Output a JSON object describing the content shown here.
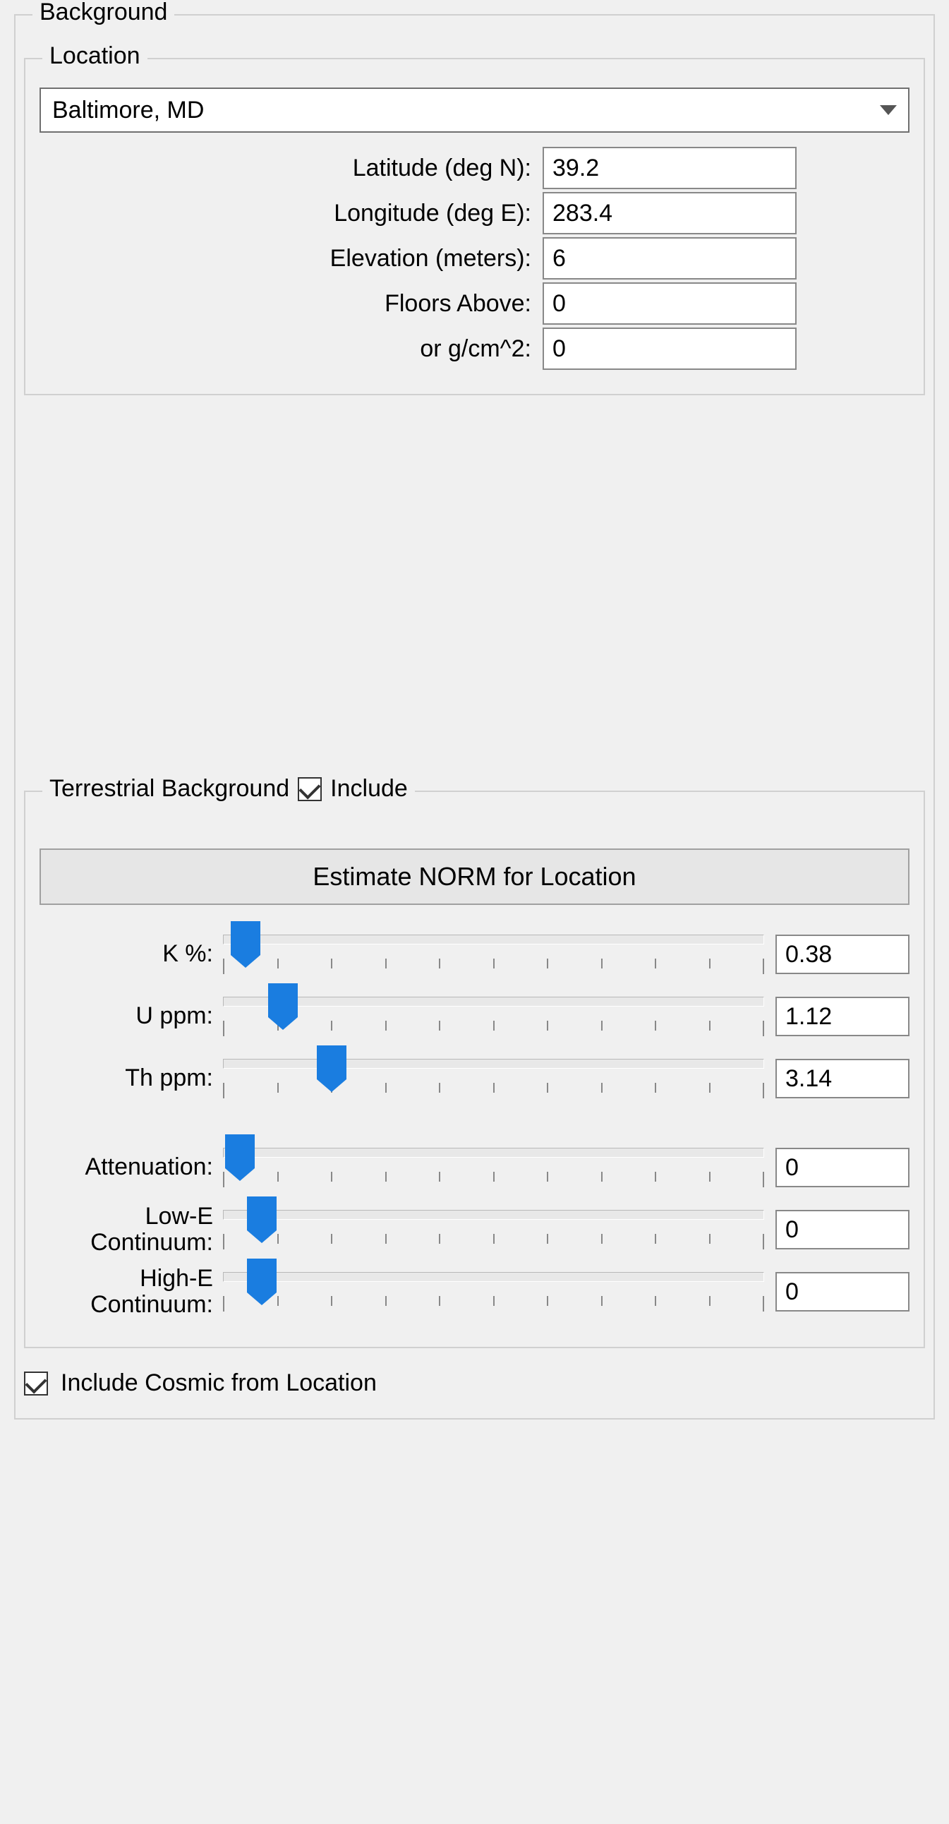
{
  "groups": {
    "background": "Background",
    "location": "Location",
    "terrestrial": "Terrestrial Background",
    "include": "Include"
  },
  "location": {
    "selected": "Baltimore, MD",
    "fields": {
      "latitude": {
        "label": "Latitude (deg N):",
        "value": "39.2"
      },
      "longitude": {
        "label": "Longitude (deg E):",
        "value": "283.4"
      },
      "elevation": {
        "label": "Elevation (meters):",
        "value": "6"
      },
      "floors": {
        "label": "Floors Above:",
        "value": "0"
      },
      "gcm2": {
        "label": "or g/cm^2:",
        "value": "0"
      }
    }
  },
  "terrestrial": {
    "include_checked": true,
    "estimate_button": "Estimate NORM for Location",
    "sliders": {
      "k": {
        "label": "K %:",
        "value": "0.38",
        "pos": 4
      },
      "u": {
        "label": "U ppm:",
        "value": "1.12",
        "pos": 11
      },
      "th": {
        "label": "Th ppm:",
        "value": "3.14",
        "pos": 20
      },
      "att": {
        "label": "Attenuation:",
        "value": "0",
        "pos": 3
      },
      "lowe": {
        "label": "Low-E\nContinuum:",
        "value": "0",
        "pos": 7
      },
      "highe": {
        "label": "High-E\nContinuum:",
        "value": "0",
        "pos": 7
      }
    }
  },
  "cosmic": {
    "label": "Include Cosmic from Location",
    "checked": true
  }
}
